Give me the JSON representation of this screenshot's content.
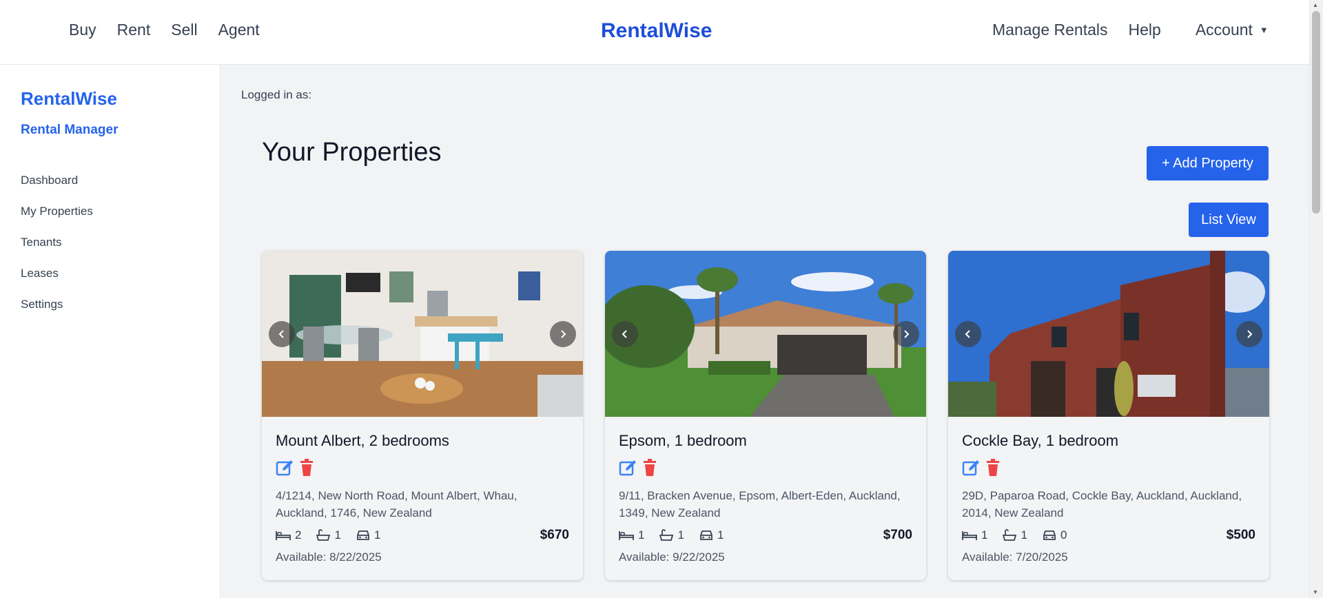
{
  "topnav": {
    "left_links": [
      "Buy",
      "Rent",
      "Sell",
      "Agent"
    ],
    "brand": "RentalWise",
    "manage": "Manage Rentals",
    "help": "Help",
    "account": "Account"
  },
  "sidebar": {
    "brand": "RentalWise",
    "subtitle": "Rental Manager",
    "items": [
      "Dashboard",
      "My Properties",
      "Tenants",
      "Leases",
      "Settings"
    ]
  },
  "main": {
    "logged_in": "Logged in as:",
    "title": "Your Properties",
    "add_button": "+ Add Property",
    "list_view_button": "List View"
  },
  "properties": [
    {
      "title": "Mount Albert, 2 bedrooms",
      "address": "4/1214, New North Road, Mount Albert, Whau, Auckland, 1746, New Zealand",
      "beds": "2",
      "baths": "1",
      "parking": "1",
      "price": "$670",
      "available": "Available: 8/22/2025",
      "photo_icon": "interior-kitchen-photo"
    },
    {
      "title": "Epsom, 1 bedroom",
      "address": "9/11, Bracken Avenue, Epsom, Albert-Eden, Auckland, 1349, New Zealand",
      "beds": "1",
      "baths": "1",
      "parking": "1",
      "price": "$700",
      "available": "Available: 9/22/2025",
      "photo_icon": "house-with-garage-photo"
    },
    {
      "title": "Cockle Bay, 1 bedroom",
      "address": "29D, Paparoa Road, Cockle Bay, Auckland, Auckland, 2014, New Zealand",
      "beds": "1",
      "baths": "1",
      "parking": "0",
      "price": "$500",
      "available": "Available: 7/20/2025",
      "photo_icon": "brick-townhouse-photo"
    }
  ],
  "colors": {
    "brand": "#1d4ed8",
    "button": "#2563eb",
    "edit_icon": "#3b82f6",
    "delete_icon": "#ef4444"
  }
}
